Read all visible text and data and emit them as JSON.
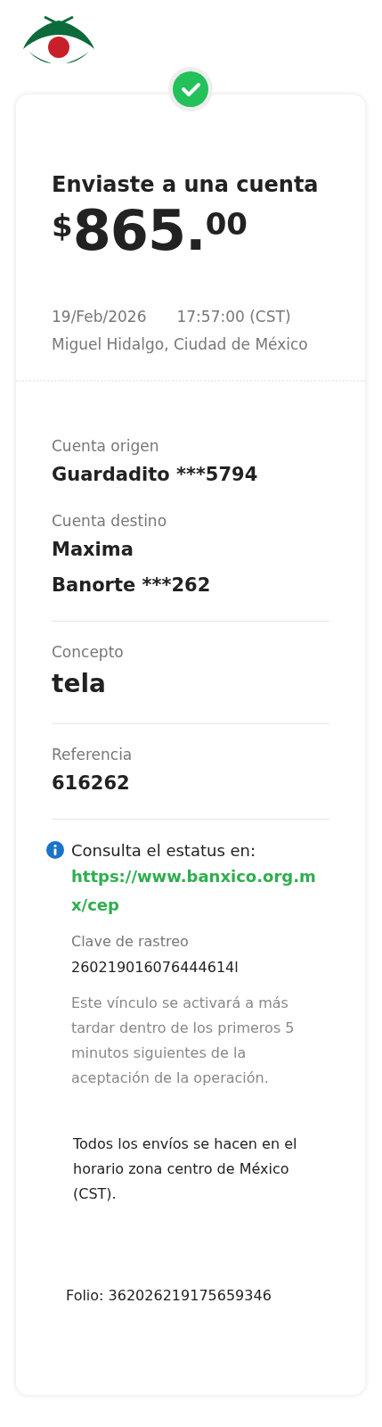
{
  "header": {
    "title": "Enviaste a una cuenta",
    "amount": {
      "currency": "$",
      "integer": "865.",
      "cents": "00"
    },
    "date": "19/Feb/2026",
    "time": "17:57:00 (CST)",
    "location": "Miguel Hidalgo, Ciudad de México"
  },
  "fields": [
    {
      "label": "Cuenta origen",
      "lines": [
        "Guardadito ***5794"
      ],
      "kind": "account",
      "divider_after": false
    },
    {
      "label": "Cuenta destino",
      "lines": [
        "Maxima",
        "Banorte ***262"
      ],
      "kind": "account",
      "divider_after": true
    },
    {
      "label": "Concepto",
      "lines": [
        "tela"
      ],
      "kind": "concept",
      "divider_after": true
    },
    {
      "label": "Referencia",
      "lines": [
        "616262"
      ],
      "kind": "account",
      "divider_after": true
    }
  ],
  "status_info": {
    "text": "Consulta el estatus en:",
    "link": "https://www.banxico.org.mx/cep",
    "tracking_label": "Clave de rastreo",
    "tracking_value": "260219016076444614l",
    "note": "Este vínculo se activará a más tardar dentro de los primeros 5 minutos siguientes de la aceptación de la operación."
  },
  "timezone_note": "Todos los envíos se hacen en el horario zona centro de México (CST).",
  "folio": "Folio: 362026219175659346"
}
